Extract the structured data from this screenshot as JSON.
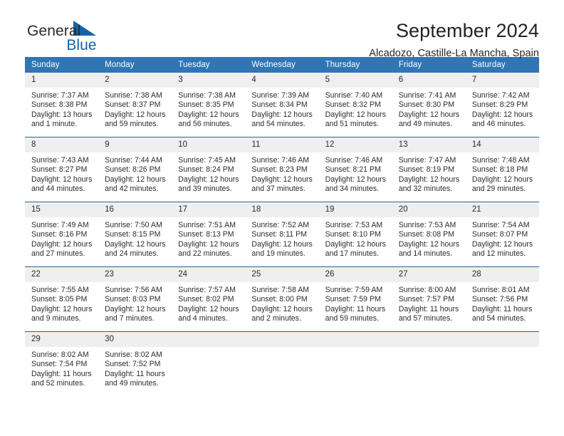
{
  "brand": {
    "line1": "General",
    "line2": "Blue",
    "logo_icon": "triangle-logo-icon",
    "accent_color": "#1464a5"
  },
  "header": {
    "title": "September 2024",
    "subtitle": "Alcadozo, Castille-La Mancha, Spain"
  },
  "calendar": {
    "header_bg": "#3075b4",
    "row_divider_color": "#24639f",
    "daynum_bg": "#efefef",
    "weekdays": [
      "Sunday",
      "Monday",
      "Tuesday",
      "Wednesday",
      "Thursday",
      "Friday",
      "Saturday"
    ],
    "weeks": [
      [
        {
          "day": "1",
          "sunrise": "Sunrise: 7:37 AM",
          "sunset": "Sunset: 8:38 PM",
          "daylight": "Daylight: 13 hours and 1 minute."
        },
        {
          "day": "2",
          "sunrise": "Sunrise: 7:38 AM",
          "sunset": "Sunset: 8:37 PM",
          "daylight": "Daylight: 12 hours and 59 minutes."
        },
        {
          "day": "3",
          "sunrise": "Sunrise: 7:38 AM",
          "sunset": "Sunset: 8:35 PM",
          "daylight": "Daylight: 12 hours and 56 minutes."
        },
        {
          "day": "4",
          "sunrise": "Sunrise: 7:39 AM",
          "sunset": "Sunset: 8:34 PM",
          "daylight": "Daylight: 12 hours and 54 minutes."
        },
        {
          "day": "5",
          "sunrise": "Sunrise: 7:40 AM",
          "sunset": "Sunset: 8:32 PM",
          "daylight": "Daylight: 12 hours and 51 minutes."
        },
        {
          "day": "6",
          "sunrise": "Sunrise: 7:41 AM",
          "sunset": "Sunset: 8:30 PM",
          "daylight": "Daylight: 12 hours and 49 minutes."
        },
        {
          "day": "7",
          "sunrise": "Sunrise: 7:42 AM",
          "sunset": "Sunset: 8:29 PM",
          "daylight": "Daylight: 12 hours and 46 minutes."
        }
      ],
      [
        {
          "day": "8",
          "sunrise": "Sunrise: 7:43 AM",
          "sunset": "Sunset: 8:27 PM",
          "daylight": "Daylight: 12 hours and 44 minutes."
        },
        {
          "day": "9",
          "sunrise": "Sunrise: 7:44 AM",
          "sunset": "Sunset: 8:26 PM",
          "daylight": "Daylight: 12 hours and 42 minutes."
        },
        {
          "day": "10",
          "sunrise": "Sunrise: 7:45 AM",
          "sunset": "Sunset: 8:24 PM",
          "daylight": "Daylight: 12 hours and 39 minutes."
        },
        {
          "day": "11",
          "sunrise": "Sunrise: 7:46 AM",
          "sunset": "Sunset: 8:23 PM",
          "daylight": "Daylight: 12 hours and 37 minutes."
        },
        {
          "day": "12",
          "sunrise": "Sunrise: 7:46 AM",
          "sunset": "Sunset: 8:21 PM",
          "daylight": "Daylight: 12 hours and 34 minutes."
        },
        {
          "day": "13",
          "sunrise": "Sunrise: 7:47 AM",
          "sunset": "Sunset: 8:19 PM",
          "daylight": "Daylight: 12 hours and 32 minutes."
        },
        {
          "day": "14",
          "sunrise": "Sunrise: 7:48 AM",
          "sunset": "Sunset: 8:18 PM",
          "daylight": "Daylight: 12 hours and 29 minutes."
        }
      ],
      [
        {
          "day": "15",
          "sunrise": "Sunrise: 7:49 AM",
          "sunset": "Sunset: 8:16 PM",
          "daylight": "Daylight: 12 hours and 27 minutes."
        },
        {
          "day": "16",
          "sunrise": "Sunrise: 7:50 AM",
          "sunset": "Sunset: 8:15 PM",
          "daylight": "Daylight: 12 hours and 24 minutes."
        },
        {
          "day": "17",
          "sunrise": "Sunrise: 7:51 AM",
          "sunset": "Sunset: 8:13 PM",
          "daylight": "Daylight: 12 hours and 22 minutes."
        },
        {
          "day": "18",
          "sunrise": "Sunrise: 7:52 AM",
          "sunset": "Sunset: 8:11 PM",
          "daylight": "Daylight: 12 hours and 19 minutes."
        },
        {
          "day": "19",
          "sunrise": "Sunrise: 7:53 AM",
          "sunset": "Sunset: 8:10 PM",
          "daylight": "Daylight: 12 hours and 17 minutes."
        },
        {
          "day": "20",
          "sunrise": "Sunrise: 7:53 AM",
          "sunset": "Sunset: 8:08 PM",
          "daylight": "Daylight: 12 hours and 14 minutes."
        },
        {
          "day": "21",
          "sunrise": "Sunrise: 7:54 AM",
          "sunset": "Sunset: 8:07 PM",
          "daylight": "Daylight: 12 hours and 12 minutes."
        }
      ],
      [
        {
          "day": "22",
          "sunrise": "Sunrise: 7:55 AM",
          "sunset": "Sunset: 8:05 PM",
          "daylight": "Daylight: 12 hours and 9 minutes."
        },
        {
          "day": "23",
          "sunrise": "Sunrise: 7:56 AM",
          "sunset": "Sunset: 8:03 PM",
          "daylight": "Daylight: 12 hours and 7 minutes."
        },
        {
          "day": "24",
          "sunrise": "Sunrise: 7:57 AM",
          "sunset": "Sunset: 8:02 PM",
          "daylight": "Daylight: 12 hours and 4 minutes."
        },
        {
          "day": "25",
          "sunrise": "Sunrise: 7:58 AM",
          "sunset": "Sunset: 8:00 PM",
          "daylight": "Daylight: 12 hours and 2 minutes."
        },
        {
          "day": "26",
          "sunrise": "Sunrise: 7:59 AM",
          "sunset": "Sunset: 7:59 PM",
          "daylight": "Daylight: 11 hours and 59 minutes."
        },
        {
          "day": "27",
          "sunrise": "Sunrise: 8:00 AM",
          "sunset": "Sunset: 7:57 PM",
          "daylight": "Daylight: 11 hours and 57 minutes."
        },
        {
          "day": "28",
          "sunrise": "Sunrise: 8:01 AM",
          "sunset": "Sunset: 7:56 PM",
          "daylight": "Daylight: 11 hours and 54 minutes."
        }
      ],
      [
        {
          "day": "29",
          "sunrise": "Sunrise: 8:02 AM",
          "sunset": "Sunset: 7:54 PM",
          "daylight": "Daylight: 11 hours and 52 minutes."
        },
        {
          "day": "30",
          "sunrise": "Sunrise: 8:02 AM",
          "sunset": "Sunset: 7:52 PM",
          "daylight": "Daylight: 11 hours and 49 minutes."
        },
        {
          "day": "",
          "sunrise": "",
          "sunset": "",
          "daylight": ""
        },
        {
          "day": "",
          "sunrise": "",
          "sunset": "",
          "daylight": ""
        },
        {
          "day": "",
          "sunrise": "",
          "sunset": "",
          "daylight": ""
        },
        {
          "day": "",
          "sunrise": "",
          "sunset": "",
          "daylight": ""
        },
        {
          "day": "",
          "sunrise": "",
          "sunset": "",
          "daylight": ""
        }
      ]
    ]
  }
}
